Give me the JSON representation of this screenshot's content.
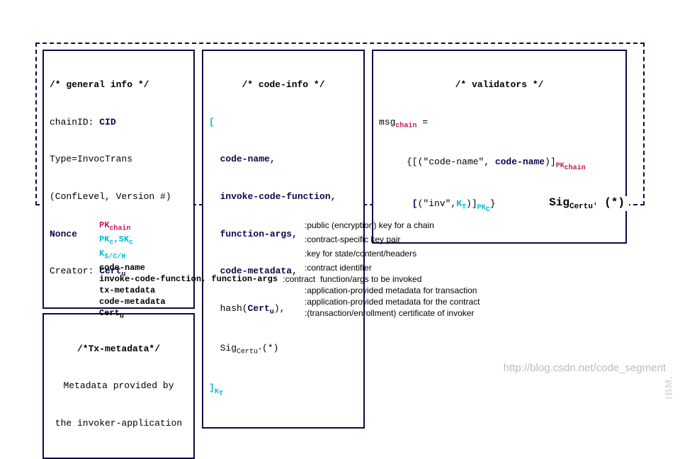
{
  "general": {
    "title": "/* general info */",
    "line1a": "chainID: ",
    "line1b": "CID",
    "line2": "Type=InvocTrans",
    "line3": "(ConfLevel, Version #)",
    "line4": "Nonce",
    "line5a": "Creator: ",
    "line5b": "Cert",
    "line5sub": "u"
  },
  "txmeta": {
    "title": "/*Tx-metadata*/",
    "line1": "Metadata provided by",
    "line2": "the invoker-application"
  },
  "code": {
    "title": "/* code-info */",
    "open": "[",
    "l1": "  code-name,",
    "l2": "  invoke-code-function,",
    "l3": "  function-args,",
    "l4": "  code-metadata,",
    "l5a": "  hash(",
    "l5b": "Cert",
    "l5sub": "u",
    "l5c": "),",
    "l6a": "  Sig",
    "l6sub": "Certu'",
    "l6b": "(*)",
    "close": "]",
    "closekey": "K",
    "closekeysub": "T"
  },
  "validators": {
    "title": "/* validators */",
    "l1a": "msg",
    "l1sub": "chain",
    "l1b": " =",
    "l2a": "     {[(\"code-name\", ",
    "l2b": "code-name",
    "l2c": ")]",
    "l2key": "PK",
    "l2keysub": "chain",
    "l3a": "      [",
    "l3b": "(\"inv\",",
    "l3key": "K",
    "l3keysub": "T",
    "l3c": ")]",
    "l3key2": "PK",
    "l3key2sub": "C",
    "l3d": "}"
  },
  "sig": {
    "a": "Sig",
    "sub": "Certu'",
    "b": " (*)"
  },
  "legend": [
    {
      "k": "PK",
      "ksub": "chain",
      "kcolor": "magenta",
      "v": ":public (encryption) key for a chain"
    },
    {
      "k": "PK",
      "ksub": "c",
      "k2": ",SK",
      "k2sub": "c",
      "kcolor": "cyan",
      "v": ":contract-specific key pair"
    },
    {
      "k": "K",
      "ksub": "S/C/H",
      "kcolor": "cyan",
      "v": ":key for state/content/headers"
    },
    {
      "k": "code-name",
      "v": ":contract identifier"
    },
    {
      "k": "invoke-code-function, function-args ",
      "v": ":contract  function/args to be invoked",
      "wide": true
    },
    {
      "k": "tx-metadata",
      "v": ":application-provided metadata for transaction"
    },
    {
      "k": "code-metadata",
      "v": ":application-provided metadata for the contract"
    },
    {
      "k": "Cert",
      "ksub": "u",
      "v": ":(transaction/enrollment) certificate of invoker"
    }
  ],
  "watermark": "http://blog.csdn.net/code_segment",
  "ibm": "IBM."
}
